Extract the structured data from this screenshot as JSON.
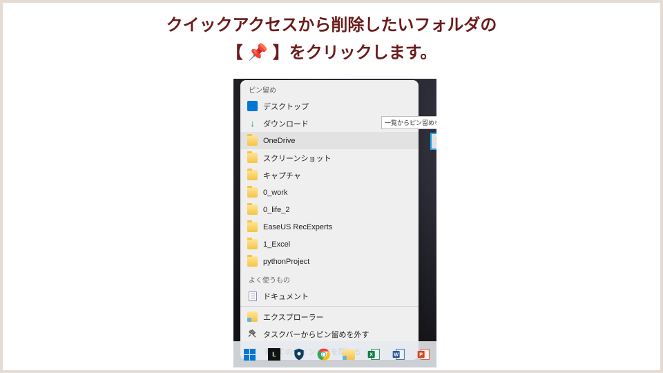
{
  "instruction": {
    "line1": "クイックアクセスから削除したいフォルダの",
    "line2_pre": "【 ",
    "line2_emoji": "📌",
    "line2_post": " 】をクリックします。"
  },
  "tooltip": "一覧からピン留めを外",
  "sections": {
    "pinned_header": "ピン留め",
    "frequent_header": "よく使うもの"
  },
  "pinned_items": [
    {
      "icon": "desktop",
      "label": "デスクトップ"
    },
    {
      "icon": "download",
      "label": "ダウンロード"
    },
    {
      "icon": "folder",
      "label": "OneDrive"
    },
    {
      "icon": "folder",
      "label": "スクリーンショット"
    },
    {
      "icon": "folder",
      "label": "キャプチャ"
    },
    {
      "icon": "folder",
      "label": "0_work"
    },
    {
      "icon": "folder",
      "label": "0_life_2"
    },
    {
      "icon": "folder",
      "label": "EaseUS RecExperts"
    },
    {
      "icon": "folder",
      "label": "1_Excel"
    },
    {
      "icon": "folder",
      "label": "pythonProject"
    }
  ],
  "frequent_items": [
    {
      "icon": "document",
      "label": "ドキュメント"
    }
  ],
  "actions": {
    "explorer": "エクスプローラー",
    "unpin": "タスクバーからピン留めを外す",
    "close_all": "すべてのウィンドウを閉じる"
  },
  "taskbar_apps": [
    "start",
    "unknown",
    "security",
    "chrome",
    "explorer",
    "excel",
    "word",
    "powerpoint"
  ]
}
